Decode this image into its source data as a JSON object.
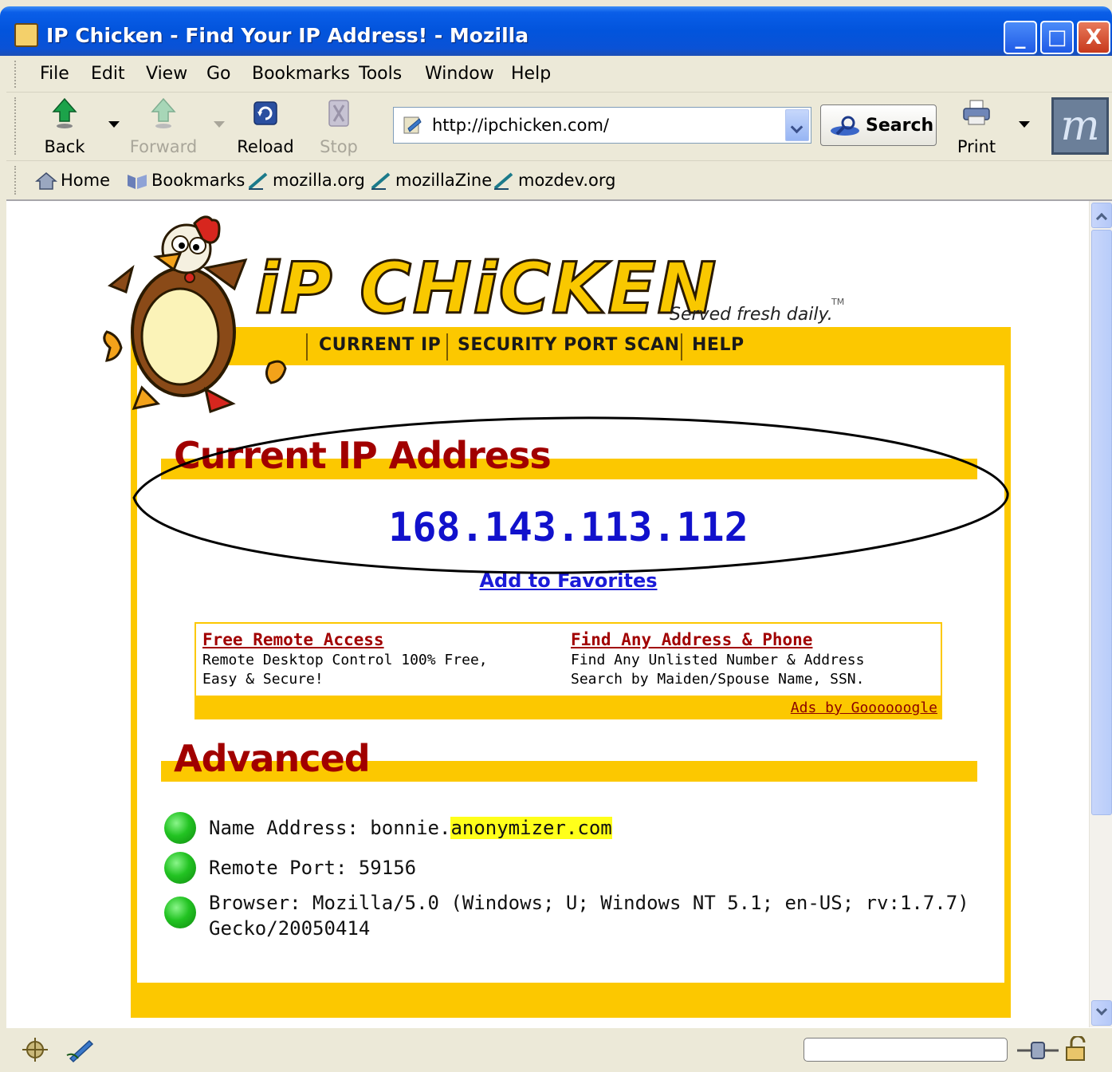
{
  "window": {
    "title": "IP Chicken - Find Your IP Address! - Mozilla",
    "minimize": "_",
    "maximize": "□",
    "close": "X"
  },
  "menu": {
    "items": [
      {
        "label": "File"
      },
      {
        "label": "Edit"
      },
      {
        "label": "View"
      },
      {
        "label": "Go"
      },
      {
        "label": "Bookmarks"
      },
      {
        "label": "Tools"
      },
      {
        "label": "Window"
      },
      {
        "label": "Help"
      }
    ]
  },
  "navbar": {
    "back": "Back",
    "forward": "Forward",
    "reload": "Reload",
    "stop": "Stop",
    "url": "http://ipchicken.com/",
    "search": "Search",
    "print": "Print",
    "logo_letter": "m"
  },
  "bookmarks": {
    "items": [
      {
        "label": "Home"
      },
      {
        "label": "Bookmarks"
      },
      {
        "label": "mozilla.org"
      },
      {
        "label": "mozillaZine"
      },
      {
        "label": "mozdev.org"
      }
    ]
  },
  "page": {
    "brand": "iP CHiCKEN",
    "tagline": "Served fresh daily.",
    "tm": "TM",
    "nav": [
      "CURRENT IP",
      "SECURITY PORT SCAN",
      "HELP"
    ],
    "current_title": "Current IP Address",
    "ip": "168.143.113.112",
    "favorites": "Add to Favorites",
    "ads": [
      {
        "title": "Free Remote Access",
        "desc1": "Remote Desktop Control 100% Free,",
        "desc2": "Easy & Secure!"
      },
      {
        "title": "Find Any Address & Phone",
        "desc1": "Find Any Unlisted Number & Address",
        "desc2": "Search by Maiden/Spouse Name, SSN."
      }
    ],
    "ads_by": "Ads by Goooooogle",
    "advanced_title": "Advanced",
    "advanced": {
      "name_label": "Name Address: bonnie.",
      "name_host": "anonymizer.com",
      "port": "Remote Port: 59156",
      "browser_line1": "Browser: Mozilla/5.0 (Windows; U; Windows NT 5.1; en-US; rv:1.7.7)",
      "browser_line2": "Gecko/20050414"
    }
  },
  "colors": {
    "accent_yellow": "#fcc800",
    "title_red": "#a10000",
    "ip_blue": "#1111cc"
  }
}
